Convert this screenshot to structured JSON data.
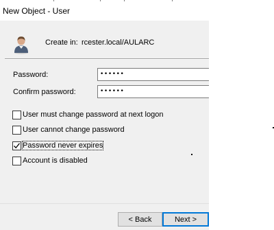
{
  "window": {
    "title": "New Object - User"
  },
  "header": {
    "create_label": "Create in:",
    "create_path": "rcester.local/AULARC",
    "icon": "user-icon"
  },
  "password": {
    "label": "Password:",
    "value": "••••••"
  },
  "confirm_password": {
    "label": "Confirm password:",
    "value": "••••••"
  },
  "options": [
    {
      "label": "User must change password at next logon",
      "checked": false
    },
    {
      "label": "User cannot change password",
      "checked": false
    },
    {
      "label": "Password never expires",
      "checked": true
    },
    {
      "label": "Account is disabled",
      "checked": false
    }
  ],
  "buttons": {
    "back": "< Back",
    "next": "Next >"
  }
}
